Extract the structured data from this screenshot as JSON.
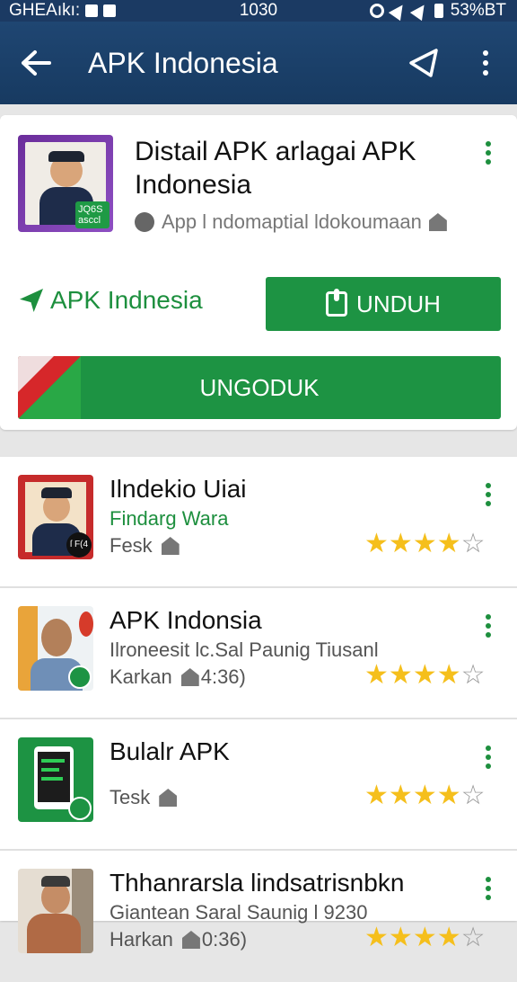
{
  "status_bar": {
    "carrier": "GHEAıkı:",
    "time": "1030",
    "battery": "53%BT"
  },
  "app_bar": {
    "title": "APK Indonesia"
  },
  "detail": {
    "title": "Distail APK arlagai APK Indonesia",
    "meta": "App l ndomaptial ldokoumaan",
    "thumb_badge": "JQ6S asccl",
    "developer_link": "APK Indnesia",
    "download_label": "UNDUH",
    "ungoduk_label": "UNGODUK"
  },
  "list": [
    {
      "title": "Ilndekio Uiai",
      "subtitle": "Findarg Wara",
      "meta": "Fesk",
      "rating": 4,
      "badge": "ſ F(4"
    },
    {
      "title": "APK Indonsia",
      "subtitle": "Ilroneesit lc.Sal Paunig Tiusanl",
      "meta": "Karkan",
      "meta_extra": "4:36)",
      "rating": 4
    },
    {
      "title": "Bulalr APK",
      "subtitle": "",
      "meta": "Tesk",
      "rating": 4
    },
    {
      "title": "Thhanrarsla lindsatrisnbkn",
      "subtitle": "Giantean Saral Saunig l 9230",
      "meta": "Harkan",
      "meta_extra": "0:36)",
      "rating": 4
    }
  ],
  "colors": {
    "app_bar": "#1b3a63",
    "accent_green": "#1d9343",
    "star": "#f5bf1c"
  }
}
